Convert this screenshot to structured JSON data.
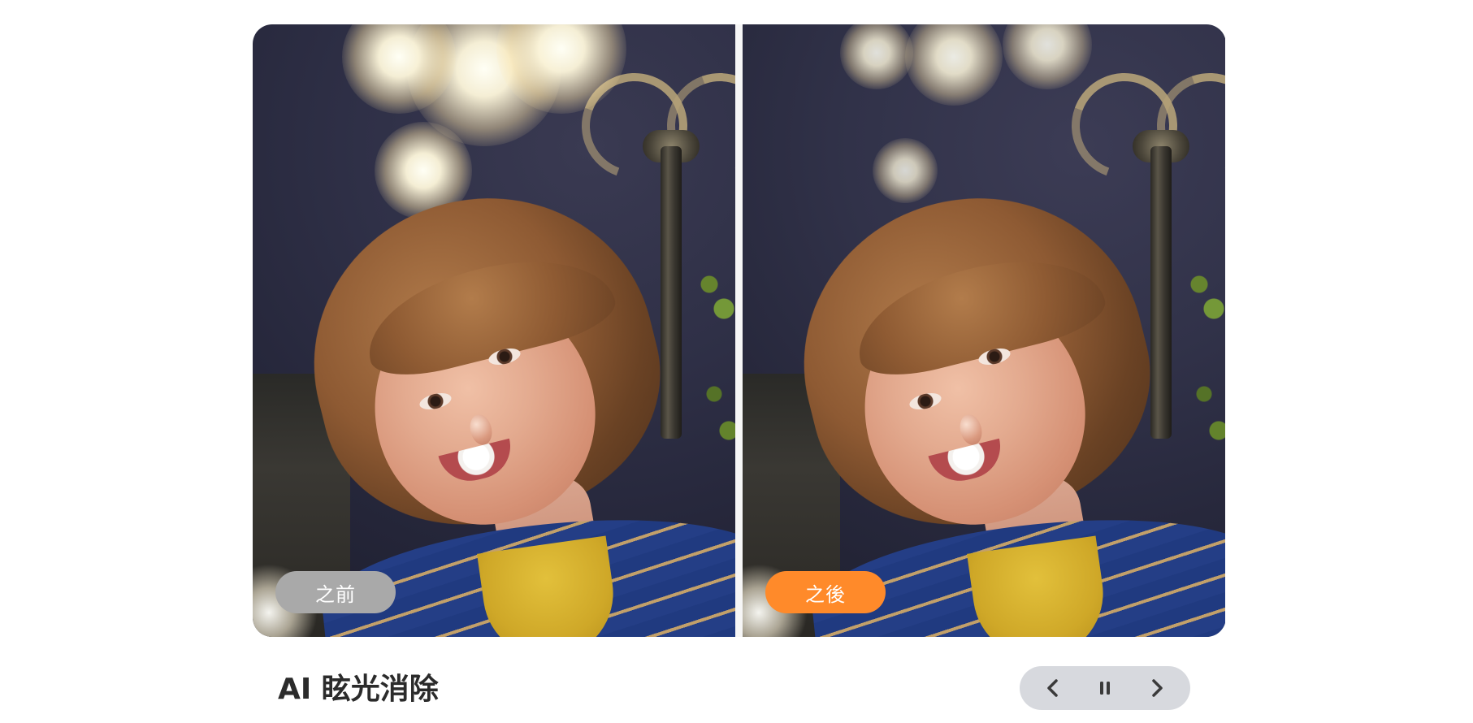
{
  "comparison": {
    "before_label": "之前",
    "after_label": "之後"
  },
  "feature": {
    "title": "AI 眩光消除"
  },
  "controls": {
    "prev_icon": "chevron-left-icon",
    "pause_icon": "pause-icon",
    "next_icon": "chevron-right-icon"
  },
  "colors": {
    "before_badge": "#a9a9a9",
    "after_badge": "#ff8a2a",
    "controls_bg": "#d7d9de",
    "title_text": "#2b2b2b"
  }
}
